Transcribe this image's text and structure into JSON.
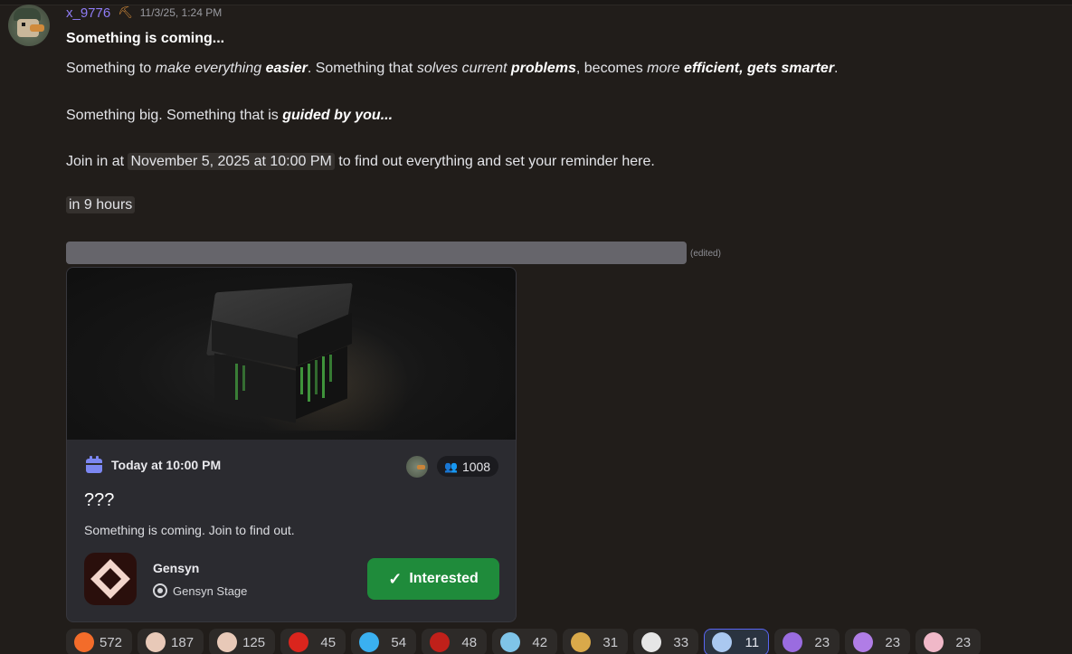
{
  "message": {
    "username": "x_9776",
    "role_icon": "pickaxe-icon",
    "timestamp": "11/3/25, 1:24 PM",
    "title": "Something is coming...",
    "p1": {
      "t1": "Something to ",
      "t2": "make everything ",
      "t3": "easier",
      "t4": ". Something that ",
      "t5": "solves current ",
      "t6": "problems",
      "t7": ", becomes ",
      "t8": "more ",
      "t9": "efficient",
      "t10": ", ",
      "t11": "gets smarter",
      "t12": "."
    },
    "p2": {
      "t1": "Something big. Something that is ",
      "t2": "guided by you..."
    },
    "p3": {
      "t1": "Join in at ",
      "date": "November 5, 2025 at 10:00 PM",
      "t2": " to find out everything and set your reminder here."
    },
    "relative_time": "in 9 hours",
    "edited": "(edited)"
  },
  "event": {
    "time": "Today at 10:00 PM",
    "interested_count": "1008",
    "title": "???",
    "description": "Something is coming. Join to find out.",
    "guild": "Gensyn",
    "channel": "Gensyn Stage",
    "interested_label": "Interested"
  },
  "reactions": [
    {
      "count": "572",
      "emoji": "fire-emoji",
      "color": "#f36c2a"
    },
    {
      "count": "187",
      "emoji": "anime-girl-emoji",
      "color": "#e8c9b8"
    },
    {
      "count": "125",
      "emoji": "anime-girl-emoji-2",
      "color": "#e8c9b8"
    },
    {
      "count": "45",
      "emoji": "vietnam-flag-emoji",
      "color": "#da251d"
    },
    {
      "count": "54",
      "emoji": "blue-blob-emoji",
      "color": "#3ab0f0"
    },
    {
      "count": "48",
      "emoji": "red-hood-emoji",
      "color": "#c0201a"
    },
    {
      "count": "42",
      "emoji": "blue-cat-emoji",
      "color": "#7fc4e8"
    },
    {
      "count": "31",
      "emoji": "crowned-cat-emoji",
      "color": "#d9a94a"
    },
    {
      "count": "33",
      "emoji": "white-cat-emoji",
      "color": "#e6e6e6"
    },
    {
      "count": "11",
      "emoji": "flag-emoji",
      "color": "#aac8f0",
      "active": true
    },
    {
      "count": "23",
      "emoji": "purple-castle-emoji",
      "color": "#9a6ce0"
    },
    {
      "count": "23",
      "emoji": "purple-bird-emoji",
      "color": "#b07de6"
    },
    {
      "count": "23",
      "emoji": "pink-bunny-emoji",
      "color": "#f0b8c8"
    }
  ]
}
